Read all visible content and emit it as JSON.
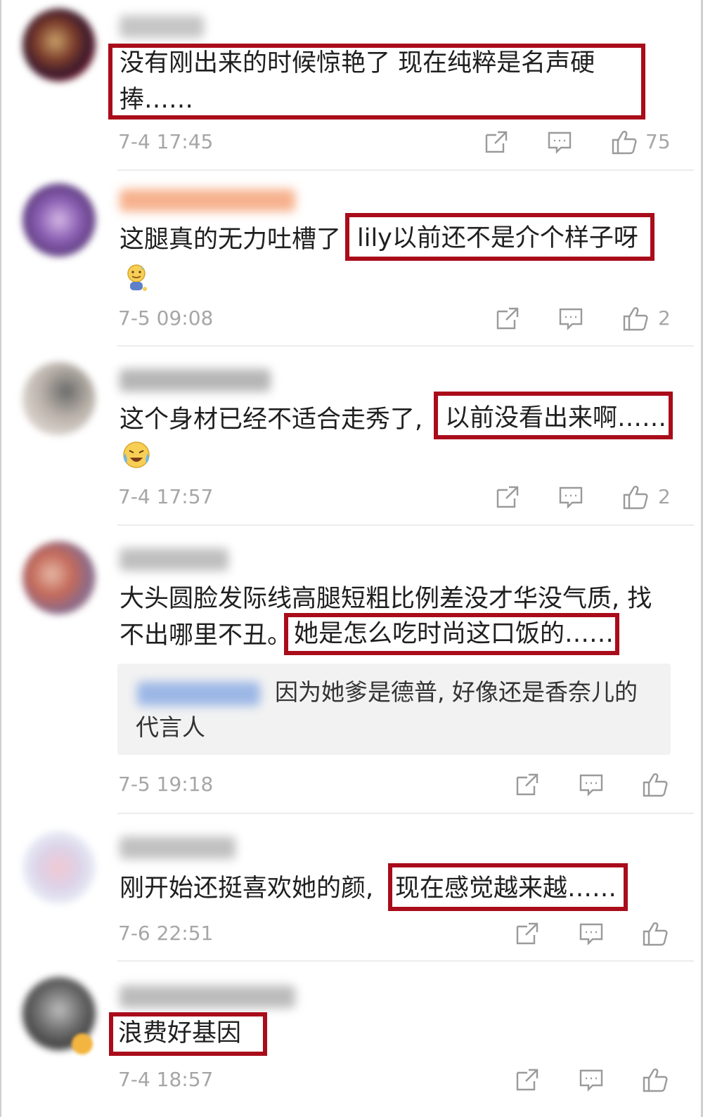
{
  "comments": [
    {
      "lines": [
        "没有刚出来的时候惊艳了  现在纯粹是名声硬",
        "捧……"
      ],
      "timestamp": "7-4 17:45",
      "likes": "75",
      "icons": [
        "share-icon",
        "comment-icon",
        "like-icon"
      ]
    },
    {
      "prefix": "这腿真的无力吐槽了",
      "highlight": "lily以前还不是介个样子呀",
      "emoji": "sweat-smile-emoji",
      "timestamp": "7-5 09:08",
      "likes": "2"
    },
    {
      "prefix": "这个身材已经不适合走秀了,",
      "highlight": "以前没看出来啊……",
      "emoji": "laugh-cry-emoji",
      "timestamp": "7-4 17:57",
      "likes": "2"
    },
    {
      "line1": "大头圆脸发际线高腿短粗比例差没才华没气质, 找",
      "prefix": "不出哪里不丑。",
      "highlight": "她是怎么吃时尚这口饭的……",
      "reply_lines": [
        "因为她爹是德普, 好像还是香奈儿的",
        "代言人"
      ],
      "timestamp": "7-5 19:18",
      "likes": ""
    },
    {
      "prefix": "刚开始还挺喜欢她的颜,",
      "highlight": "现在感觉越来越……",
      "timestamp": "7-6 22:51",
      "likes": ""
    },
    {
      "highlight": "浪费好基因",
      "timestamp": "7-4 18:57",
      "likes": ""
    }
  ],
  "colors": {
    "highlight_border": "#a90c1a",
    "timestamp": "#a6a6a6",
    "reply_background": "#f2f2f2"
  }
}
